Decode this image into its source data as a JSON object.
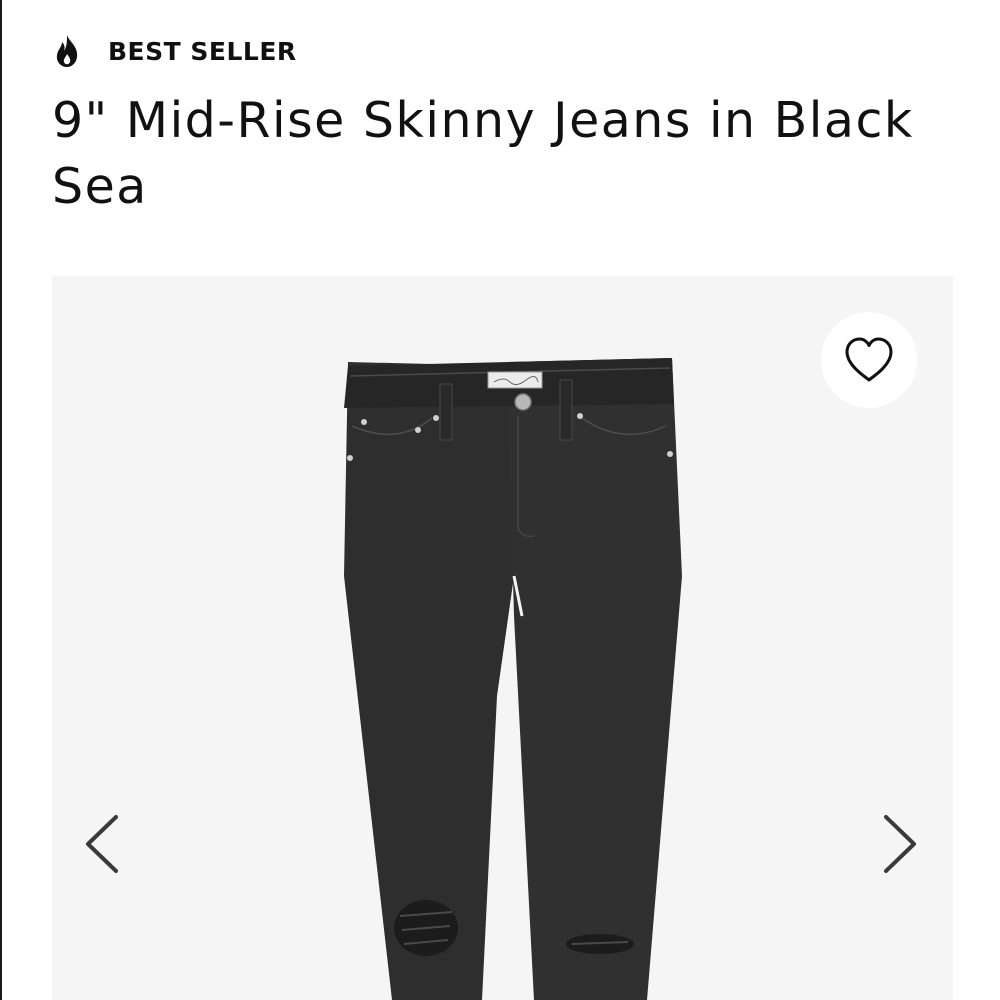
{
  "product": {
    "badge_label": "BEST SELLER",
    "badge_icon": "flame-icon",
    "title": "9\" Mid-Rise Skinny Jeans in Black Sea"
  },
  "gallery": {
    "image_subject": "black-skinny-jeans",
    "wishlist_icon": "heart-outline-icon",
    "prev_icon": "chevron-left-icon",
    "next_icon": "chevron-right-icon",
    "background_color": "#f5f5f5",
    "product_color": "#2e2e2e"
  }
}
